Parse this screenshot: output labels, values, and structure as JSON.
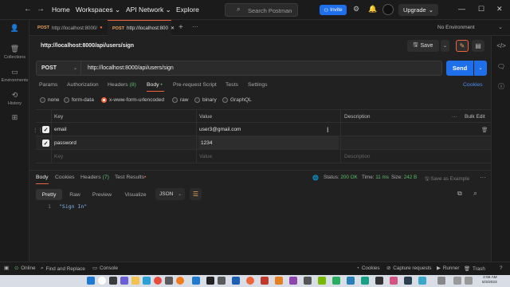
{
  "topbar": {
    "nav": [
      "Home",
      "Workspaces",
      "API Network",
      "Explore"
    ],
    "search_placeholder": "Search Postman",
    "invite_label": "Invite",
    "upgrade_label": "Upgrade"
  },
  "rail": [
    {
      "label": "Collections",
      "icon": "collections-icon"
    },
    {
      "label": "Environments",
      "icon": "environments-icon"
    },
    {
      "label": "History",
      "icon": "history-icon"
    },
    {
      "label": "",
      "icon": "apps-icon"
    }
  ],
  "tabs": [
    {
      "method": "POST",
      "url": "http://localhost:8000/",
      "active": false
    },
    {
      "method": "POST",
      "url": "http://localhost:800",
      "active": true
    }
  ],
  "environment": "No Environment",
  "request": {
    "title": "http://localhost:8000/api/users/sign",
    "save_label": "Save",
    "method": "POST",
    "url": "http://localhost:8000/api/users/sign",
    "send_label": "Send"
  },
  "request_tabs": {
    "params": "Params",
    "authorization": "Authorization",
    "headers": "Headers",
    "headers_count": "(8)",
    "body": "Body",
    "body_dot": "•",
    "prerequest": "Pre-request Script",
    "tests": "Tests",
    "settings": "Settings",
    "cookies": "Cookies"
  },
  "body_types": [
    "none",
    "form-data",
    "x-www-form-urlencoded",
    "raw",
    "binary",
    "GraphQL"
  ],
  "params_table": {
    "headers": {
      "key": "Key",
      "value": "Value",
      "description": "Description",
      "bulk_edit": "Bulk Edit"
    },
    "rows": [
      {
        "key": "email",
        "value": "user3@gmail.com",
        "checked": true
      },
      {
        "key": "password",
        "value": "1234",
        "checked": true
      }
    ],
    "placeholder": {
      "key": "Key",
      "value": "Value",
      "description": "Description"
    }
  },
  "response": {
    "tabs": {
      "body": "Body",
      "cookies": "Cookies",
      "headers": "Headers",
      "headers_count": "(7)",
      "test_results": "Test Results",
      "test_dot": "•"
    },
    "status_label": "Status:",
    "status_value": "200 OK",
    "time_label": "Time:",
    "time_value": "11 ms",
    "size_label": "Size:",
    "size_value": "242 B",
    "save_example": "Save as Example",
    "views": [
      "Pretty",
      "Raw",
      "Preview",
      "Visualize"
    ],
    "format": "JSON",
    "line_number": "1",
    "body_text": "\"Sign In\""
  },
  "statusbar": {
    "online": "Online",
    "find_replace": "Find and Replace",
    "console": "Console",
    "cookies": "Cookies",
    "capture": "Capture requests",
    "runner": "Runner",
    "trash": "Trash"
  },
  "clock": {
    "time": "2:55 AM",
    "date": "5/3/2023"
  },
  "colors": {
    "accent": "#f0643b",
    "primary": "#1f6feb",
    "success": "#5bbf6b"
  }
}
